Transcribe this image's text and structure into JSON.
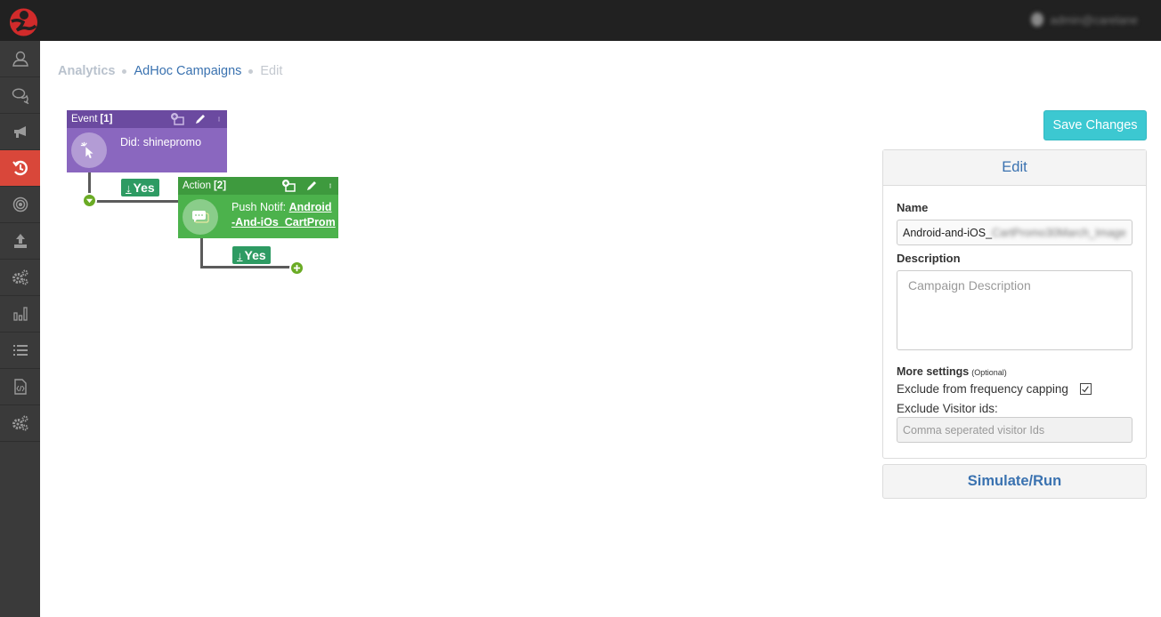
{
  "topbar": {
    "user_name": "admin@carelane"
  },
  "sidebar": {
    "items": [
      {
        "id": "users",
        "icon": "user-icon",
        "active": false
      },
      {
        "id": "conversations",
        "icon": "chat-icon",
        "active": false
      },
      {
        "id": "campaigns",
        "icon": "megaphone-icon",
        "active": false
      },
      {
        "id": "adhoc",
        "icon": "history-icon",
        "active": true
      },
      {
        "id": "targets",
        "icon": "target-icon",
        "active": false
      },
      {
        "id": "upload",
        "icon": "upload-icon",
        "active": false
      },
      {
        "id": "settings",
        "icon": "gears-icon",
        "active": false
      },
      {
        "id": "analytics",
        "icon": "bar-chart-icon",
        "active": false
      },
      {
        "id": "lists",
        "icon": "list-icon",
        "active": false
      },
      {
        "id": "code",
        "icon": "code-file-icon",
        "active": false
      },
      {
        "id": "advanced-settings",
        "icon": "gears-icon",
        "active": false
      }
    ],
    "colors": {
      "background": "#3a3a3a",
      "active": "#d9473a"
    }
  },
  "breadcrumb": {
    "items": [
      "Analytics",
      "AdHoc Campaigns",
      "Edit"
    ]
  },
  "flow": {
    "event_node": {
      "type_label": "Event",
      "index": "[1]",
      "text": "Did: shinepromo",
      "color": "#8a67bf"
    },
    "yes_badge_1": "Yes",
    "action_node": {
      "type_label": "Action",
      "index": "[2]",
      "text_prefix": "Push Notif: ",
      "link_text": "Android -And-iOs_CartProm",
      "color": "#4cb24c"
    },
    "yes_badge_2": "Yes"
  },
  "toolbar": {
    "save_label": "Save Changes"
  },
  "edit_panel": {
    "title": "Edit",
    "name_label": "Name",
    "name_value_visible": "Android-and-iOS_",
    "name_value_redacted": "CartPromo30March_Image",
    "description_label": "Description",
    "description_placeholder": "Campaign Description",
    "more_settings_label": "More settings",
    "more_settings_hint": "(Optional)",
    "freq_capping_label": "Exclude from frequency capping",
    "freq_capping_checked": true,
    "visitor_ids_label": "Exclude Visitor ids:",
    "visitor_ids_placeholder": "Comma seperated visitor Ids"
  },
  "simulate": {
    "label": "Simulate/Run"
  }
}
